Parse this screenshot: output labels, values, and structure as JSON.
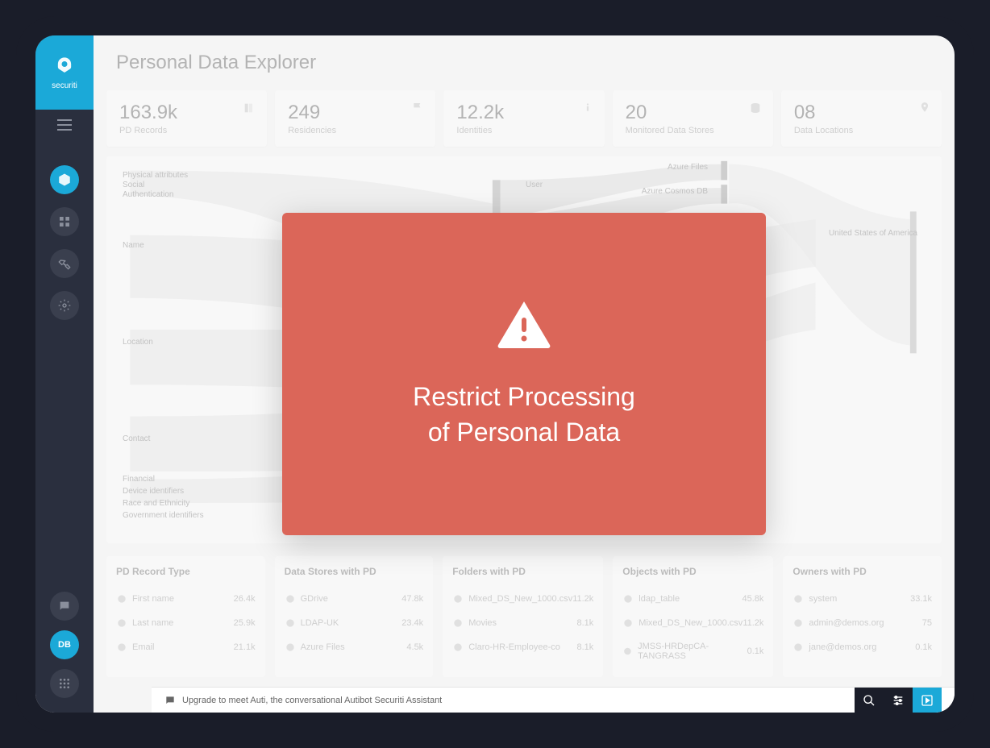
{
  "brand": {
    "name": "securiti"
  },
  "page": {
    "title": "Personal Data Explorer"
  },
  "stats": [
    {
      "value": "163.9k",
      "label": "PD Records"
    },
    {
      "value": "249",
      "label": "Residencies"
    },
    {
      "value": "12.2k",
      "label": "Identities"
    },
    {
      "value": "20",
      "label": "Monitored Data Stores"
    },
    {
      "value": "08",
      "label": "Data Locations"
    }
  ],
  "sankey": {
    "left_labels": [
      "Physical attributes",
      "Social",
      "Authentication",
      "Name",
      "Location",
      "Contact",
      "Financial",
      "Device identifiers",
      "Race and Ethnicity",
      "Government identifiers"
    ],
    "middle_label": "User",
    "right_labels": [
      "Azure Files",
      "Azure Cosmos DB"
    ],
    "far_right_labels": [
      "United States of America"
    ]
  },
  "tables": [
    {
      "header": "PD Record Type",
      "rows": [
        {
          "label": "First name",
          "value": "26.4k"
        },
        {
          "label": "Last name",
          "value": "25.9k"
        },
        {
          "label": "Email",
          "value": "21.1k"
        }
      ]
    },
    {
      "header": "Data Stores with PD",
      "rows": [
        {
          "label": "GDrive",
          "value": "47.8k"
        },
        {
          "label": "LDAP-UK",
          "value": "23.4k"
        },
        {
          "label": "Azure Files",
          "value": "4.5k"
        }
      ]
    },
    {
      "header": "Folders with PD",
      "rows": [
        {
          "label": "Mixed_DS_New_1000.csv",
          "value": "11.2k"
        },
        {
          "label": "Movies",
          "value": "8.1k"
        },
        {
          "label": "Claro-HR-Employee-co",
          "value": "8.1k"
        }
      ]
    },
    {
      "header": "Objects with PD",
      "rows": [
        {
          "label": "ldap_table",
          "value": "45.8k"
        },
        {
          "label": "Mixed_DS_New_1000.csv",
          "value": "11.2k"
        },
        {
          "label": "JMSS-HRDepCA-TANGRASS",
          "value": "0.1k"
        }
      ]
    },
    {
      "header": "Owners with PD",
      "rows": [
        {
          "label": "system",
          "value": "33.1k"
        },
        {
          "label": "admin@demos.org",
          "value": "75"
        },
        {
          "label": "jane@demos.org",
          "value": "0.1k"
        }
      ]
    }
  ],
  "footer": {
    "message": "Upgrade to meet Auti, the conversational Autibot Securiti Assistant"
  },
  "modal": {
    "line1": "Restrict Processing",
    "line2": "of Personal Data"
  },
  "sidebar": {
    "avatar_initials": "DB"
  }
}
